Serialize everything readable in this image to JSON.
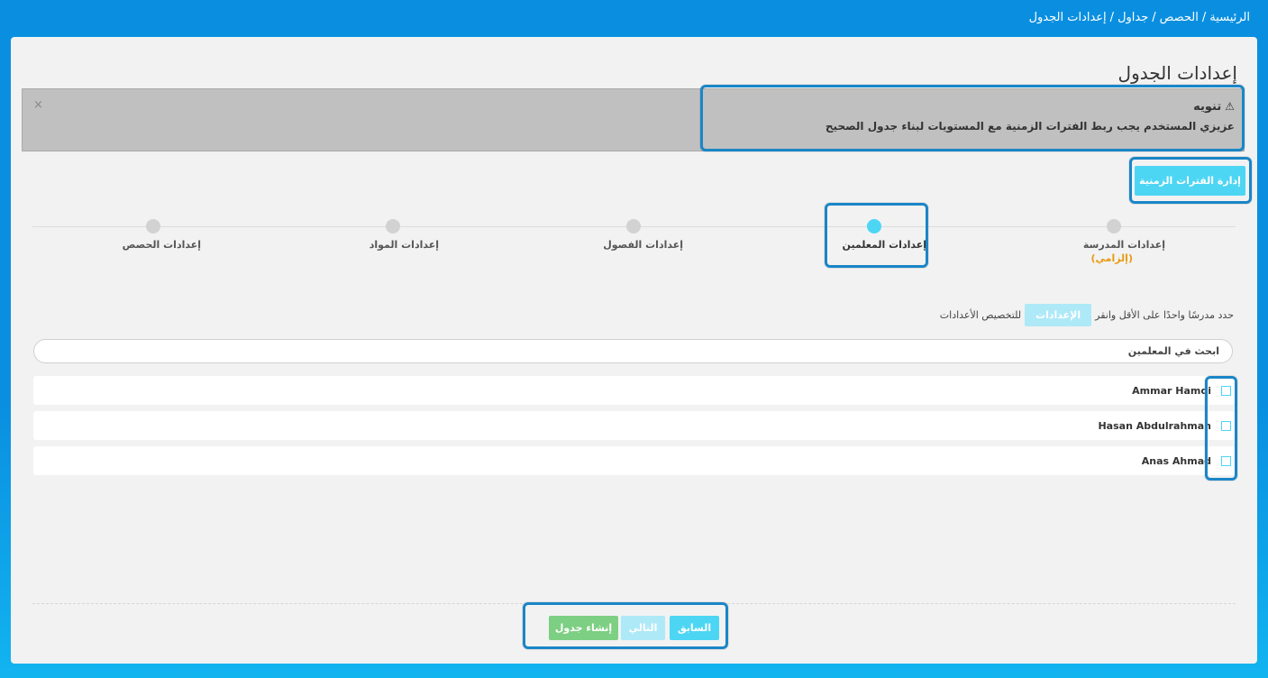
{
  "breadcrumb": {
    "items": [
      "الرئيسية",
      "الحصص",
      "جداول",
      "إعدادات الجدول"
    ],
    "separator": "/"
  },
  "page": {
    "title": "إعدادات الجدول"
  },
  "alert": {
    "icon": "warning-icon",
    "title": "تنويه",
    "text": "عزيزي المستخدم يجب ربط الفترات الزمنية مع المستويات لبناء جدول الصحيح",
    "close_label": "×"
  },
  "actions": {
    "manage_periods_label": "إدارة الفترات الزمنية"
  },
  "steps": [
    {
      "label": "إعدادات المدرسة",
      "sub": "(إلزامي)",
      "active": false
    },
    {
      "label": "إعدادات المعلمين",
      "sub": "",
      "active": true
    },
    {
      "label": "إعدادات الفصول",
      "sub": "",
      "active": false
    },
    {
      "label": "إعدادات المواد",
      "sub": "",
      "active": false
    },
    {
      "label": "إعدادات الحصص",
      "sub": "",
      "active": false
    }
  ],
  "hint": {
    "before": "حدد مدرسًا واحدًا على الأقل وانقر",
    "chip": "الإعدادات",
    "after": "للتخصيص الأعدادات"
  },
  "search": {
    "placeholder": "ابحث في المعلمين",
    "value": ""
  },
  "teachers": [
    {
      "name": "Ammar Hamdi",
      "checked": false
    },
    {
      "name": "Hasan Abdulrahman",
      "checked": false
    },
    {
      "name": "Anas Ahmad",
      "checked": false
    }
  ],
  "footer": {
    "prev_label": "السابق",
    "next_label": "التالي",
    "create_label": "إنشاء جدول"
  },
  "colors": {
    "accent": "#4dd6f4",
    "success": "#7dcf83",
    "highlight_border": "#1a86c7",
    "background": "#0a8fe0",
    "warning_text": "#e89a10"
  }
}
